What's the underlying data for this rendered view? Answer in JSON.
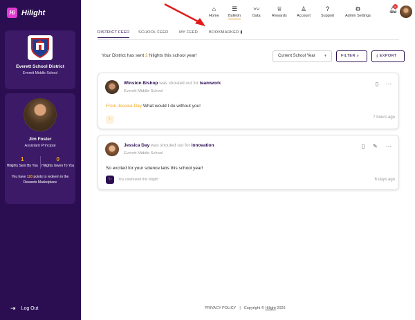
{
  "brand": {
    "name": "Hilight",
    "mark": "Hi"
  },
  "school": {
    "district": "Everett School District",
    "school": "Everett Middle School"
  },
  "user": {
    "name": "Jim Foster",
    "role": "Assistant Principal",
    "sent_count": "1",
    "sent_label": "Hilights Sent By You",
    "given_count": "0",
    "given_label": "Hilights Given To You",
    "points_prefix": "You have ",
    "points": "120",
    "points_suffix": " points to redeem in the Rewards Marketplace"
  },
  "logout_label": "Log Out",
  "nav": {
    "items": [
      {
        "label": "Home",
        "icon": "home-icon"
      },
      {
        "label": "Bulletin",
        "icon": "list-icon",
        "active": true
      },
      {
        "label": "Data",
        "icon": "trend-icon"
      },
      {
        "label": "Rewards",
        "icon": "trophy-icon"
      },
      {
        "label": "Account",
        "icon": "person-icon"
      },
      {
        "label": "Support",
        "icon": "help-icon"
      },
      {
        "label": "Admin Settings",
        "icon": "gear-icon"
      }
    ],
    "notification_count": "5"
  },
  "tabs": [
    {
      "label": "DISTRICT FEED",
      "active": true
    },
    {
      "label": "SCHOOL FEED"
    },
    {
      "label": "MY FEED"
    },
    {
      "label": "BOOKMARKED"
    }
  ],
  "toolbar": {
    "sent_prefix": "Your District has sent ",
    "sent_count": "2",
    "sent_suffix": " hilights this school year!",
    "year_select": "Current School Year",
    "filter_label": "FILTER",
    "export_label": "EXPORT"
  },
  "posts": [
    {
      "name": "Winston Bishop",
      "action": " was shouted out for ",
      "value": "teamwork",
      "school": "Everett Middle School",
      "from_label": "From Jessica Day",
      "message": "What would I do without you!",
      "time": "7 hours ago"
    },
    {
      "name": "Jessica Day",
      "action": " was shouted out for ",
      "value": "innovation",
      "school": "Everett Middle School",
      "message": "So excited for your science labs this school year!",
      "celebrated": "You celebrated this hilight!",
      "time": "6 days ago"
    }
  ],
  "footer": {
    "privacy": "PRIVACY POLICY",
    "separator": "|",
    "copyright_prefix": "Copyright © ",
    "copyright_brand": "Hilight",
    "copyright_year": " 2026"
  },
  "colors": {
    "sidebar": "#2b0d52",
    "accent": "#e58a12",
    "highlight": "#f3a81c",
    "annotation": "#e11b1b"
  }
}
